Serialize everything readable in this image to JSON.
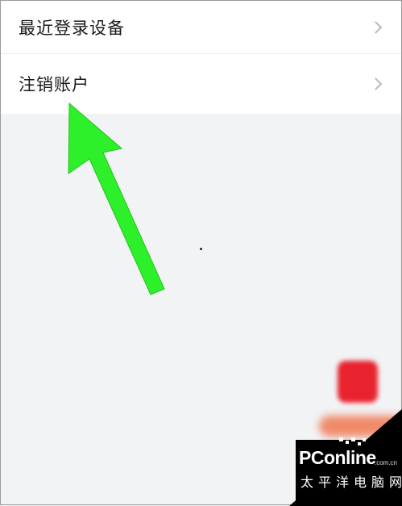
{
  "settings": {
    "items": [
      {
        "label": "最近登录设备"
      },
      {
        "label": "注销账户"
      }
    ]
  },
  "annotation": {
    "arrow_color": "#2ef02a"
  },
  "watermark": {
    "brand": "PConline",
    "domain": ".com.cn",
    "sub": "太平洋电脑网"
  }
}
